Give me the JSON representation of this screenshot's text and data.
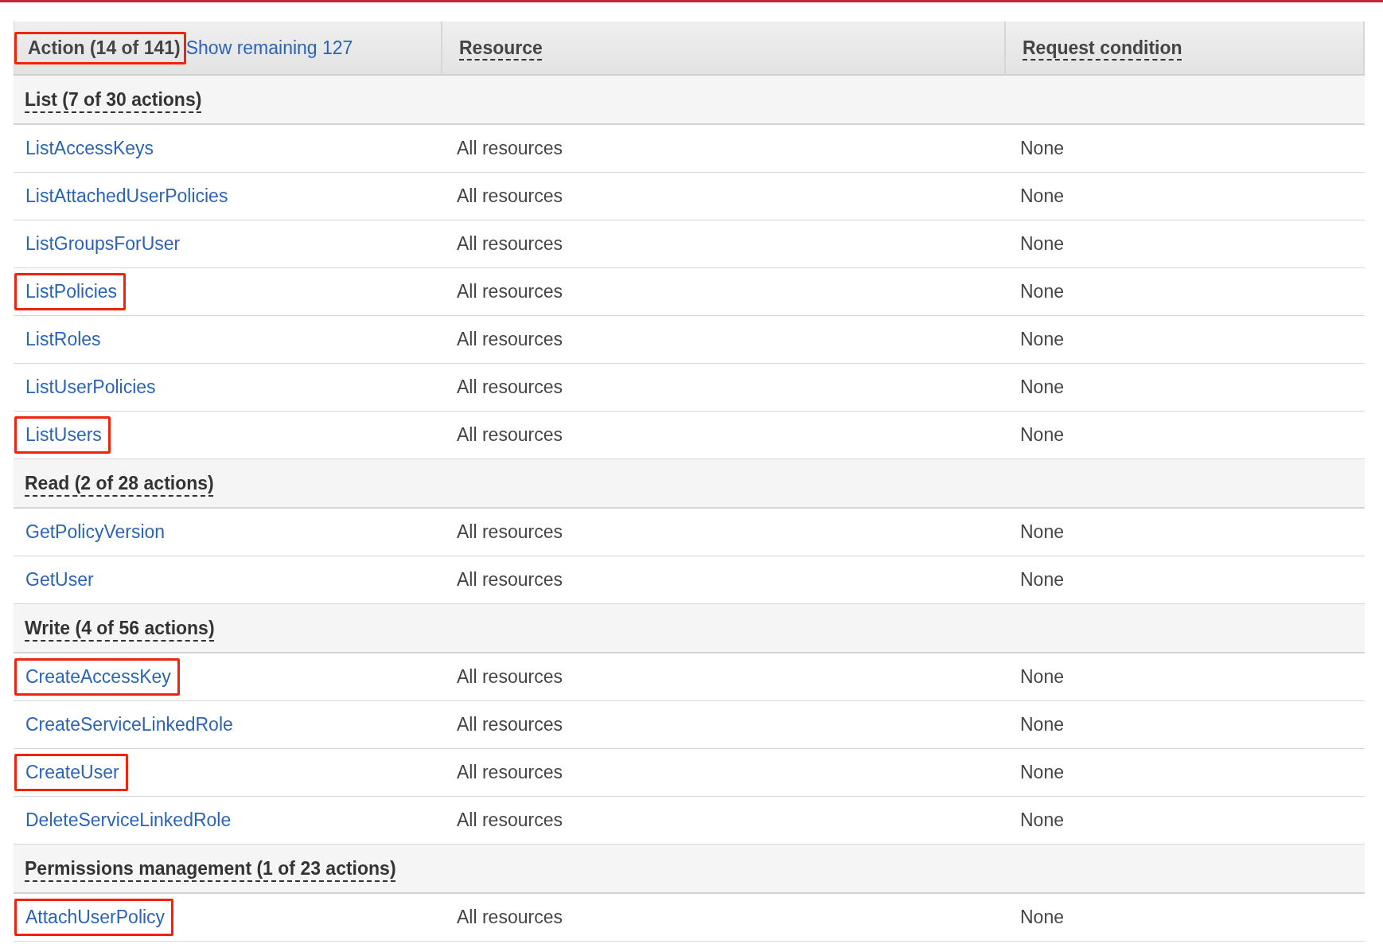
{
  "columns": [
    {
      "label": "Action (14 of 141)",
      "highlighted": true,
      "dashed_underline": false,
      "link": "Show remaining 127"
    },
    {
      "label": "Resource",
      "highlighted": false,
      "dashed_underline": true
    },
    {
      "label": "Request condition",
      "highlighted": false,
      "dashed_underline": true
    }
  ],
  "groups": [
    {
      "label": "List (7 of 30 actions)",
      "rows": [
        {
          "action": "ListAccessKeys",
          "resource": "All resources",
          "condition": "None",
          "highlighted": false
        },
        {
          "action": "ListAttachedUserPolicies",
          "resource": "All resources",
          "condition": "None",
          "highlighted": false
        },
        {
          "action": "ListGroupsForUser",
          "resource": "All resources",
          "condition": "None",
          "highlighted": false
        },
        {
          "action": "ListPolicies",
          "resource": "All resources",
          "condition": "None",
          "highlighted": true
        },
        {
          "action": "ListRoles",
          "resource": "All resources",
          "condition": "None",
          "highlighted": false
        },
        {
          "action": "ListUserPolicies",
          "resource": "All resources",
          "condition": "None",
          "highlighted": false
        },
        {
          "action": "ListUsers",
          "resource": "All resources",
          "condition": "None",
          "highlighted": true
        }
      ]
    },
    {
      "label": "Read (2 of 28 actions)",
      "rows": [
        {
          "action": "GetPolicyVersion",
          "resource": "All resources",
          "condition": "None",
          "highlighted": false
        },
        {
          "action": "GetUser",
          "resource": "All resources",
          "condition": "None",
          "highlighted": false
        }
      ]
    },
    {
      "label": "Write (4 of 56 actions)",
      "rows": [
        {
          "action": "CreateAccessKey",
          "resource": "All resources",
          "condition": "None",
          "highlighted": true
        },
        {
          "action": "CreateServiceLinkedRole",
          "resource": "All resources",
          "condition": "None",
          "highlighted": false
        },
        {
          "action": "CreateUser",
          "resource": "All resources",
          "condition": "None",
          "highlighted": true
        },
        {
          "action": "DeleteServiceLinkedRole",
          "resource": "All resources",
          "condition": "None",
          "highlighted": false
        }
      ]
    },
    {
      "label": "Permissions management (1 of 23 actions)",
      "rows": [
        {
          "action": "AttachUserPolicy",
          "resource": "All resources",
          "condition": "None",
          "highlighted": true
        }
      ]
    }
  ]
}
